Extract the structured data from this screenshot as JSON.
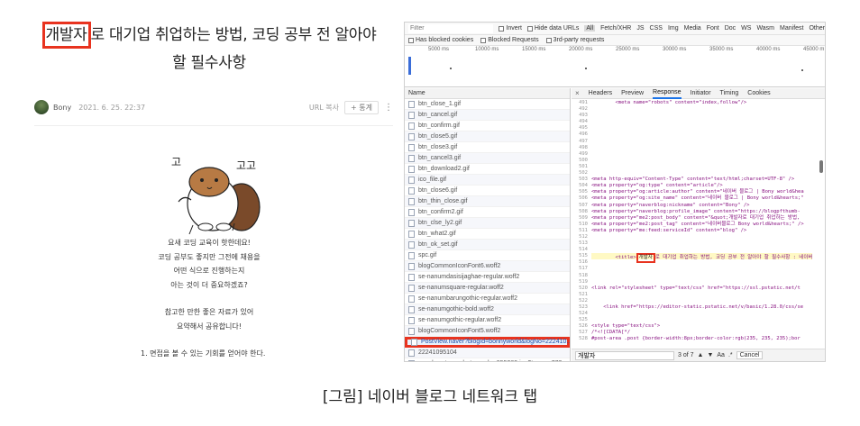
{
  "blog": {
    "title_highlight": "개발자",
    "title_rest": "로 대기업 취업하는 방법, 코딩 공부 전 알아야",
    "title_line2": "할 필수사항",
    "author": "Bony",
    "date": "2021. 6. 25. 22:37",
    "url_copy": "URL 복사",
    "share_label": "+ 통계",
    "more_icon": "more-vertical-icon",
    "mascot_text_left": "고",
    "mascot_text_right": "고고",
    "para1": [
      "요새 코딩 교육이 핫한데요!",
      "코딩 공부도 좋지만 그전에 채용을",
      "어떤 식으로 진행하는지",
      "아는 것이 더 중요하겠죠?"
    ],
    "para2": [
      "참고한 만한 좋은 자료가 있어",
      "요약해서 공유합니다!"
    ],
    "heading1": "1. 면접을 볼 수 있는 기회를 얻어야 한다."
  },
  "devtools": {
    "filter_placeholder": "Filter",
    "invert": "Invert",
    "hide_data_urls": "Hide data URLs",
    "type_tabs": [
      "All",
      "Fetch/XHR",
      "JS",
      "CSS",
      "Img",
      "Media",
      "Font",
      "Doc",
      "WS",
      "Wasm",
      "Manifest",
      "Other"
    ],
    "has_blocked_cookies": "Has blocked cookies",
    "blocked_requests": "Blocked Requests",
    "third_party": "3rd-party requests",
    "timeline_ticks": [
      "5000 ms",
      "10000 ms",
      "15000 ms",
      "20000 ms",
      "25000 ms",
      "30000 ms",
      "35000 ms",
      "40000 ms",
      "45000 m"
    ],
    "name_header": "Name",
    "rows": [
      "btn_close_1.gif",
      "btn_cancel.gif",
      "btn_confirm.gif",
      "btn_close5.gif",
      "btn_close3.gif",
      "btn_cancel3.gif",
      "btn_download2.gif",
      "ico_file.gif",
      "btn_close6.gif",
      "btn_thin_close.gif",
      "btn_confirm2.gif",
      "btn_clse_ly2.gif",
      "btn_what2.gif",
      "btn_ok_set.gif",
      "spc.gif",
      "blogCommonIconFont6.woff2",
      "se-nanumdasisijaghae-regular.woff2",
      "se-nanumsquare-regular.woff2",
      "se-nanumbarungothic-regular.woff2",
      "se-nanumgothic-bold.woff2",
      "se-nanumgothic-regular.woff2",
      "blogCommonIconFont5.woff2"
    ],
    "highlight_row": "PostView.naver?blogId=bonnyworld&logNo=222410...",
    "rows_after": [
      "22241095104",
      "pexels-cytonn-photography-955389.jpg?type=w773"
    ],
    "detail_tabs": [
      "Headers",
      "Preview",
      "Response",
      "Initiator",
      "Timing",
      "Cookies"
    ],
    "active_tab": "Response",
    "close_glyph": "×",
    "code_lines": [
      {
        "n": "491",
        "t": "        <meta name=\"robots\" content=\"index,follow\"/>"
      },
      {
        "n": "492",
        "t": ""
      },
      {
        "n": "493",
        "t": ""
      },
      {
        "n": "494",
        "t": ""
      },
      {
        "n": "495",
        "t": ""
      },
      {
        "n": "496",
        "t": ""
      },
      {
        "n": "497",
        "t": ""
      },
      {
        "n": "498",
        "t": ""
      },
      {
        "n": "499",
        "t": ""
      },
      {
        "n": "500",
        "t": ""
      },
      {
        "n": "501",
        "t": ""
      },
      {
        "n": "502",
        "t": ""
      },
      {
        "n": "503",
        "t": "<meta http-equiv=\"Content-Type\" content=\"text/html;charset=UTF-8\" />"
      },
      {
        "n": "504",
        "t": "<meta property=\"og:type\" content=\"article\"/>"
      },
      {
        "n": "505",
        "t": "<meta property=\"og:article:author\" content=\"네이버 블로그 | Bony world&hea"
      },
      {
        "n": "506",
        "t": "<meta property=\"og:site_name\" content=\"네이버 블로그 | Bony world&hearts;\""
      },
      {
        "n": "507",
        "t": "<meta property=\"naverblog:nickname\" content=\"Bony\" />"
      },
      {
        "n": "508",
        "t": "<meta property=\"naverblog:profile_image\" content=\"https://blogpfthumb-"
      },
      {
        "n": "509",
        "t": "<meta property=\"me2:post_body\" content=\"&quot;개발자로 대기업 취업하는 방법,"
      },
      {
        "n": "510",
        "t": "<meta property=\"me2:post_tag\" content=\"네이버블로그 Bony world&hearts;\" />"
      },
      {
        "n": "511",
        "t": "<meta property=\"me:feed:serviceId\" content=\"blog\" />"
      },
      {
        "n": "512",
        "t": ""
      },
      {
        "n": "513",
        "t": ""
      },
      {
        "n": "514",
        "t": ""
      }
    ],
    "title_line_no": "515",
    "title_line_pre": "        <title>",
    "title_line_mark": "개발자",
    "title_line_post": "로 대기업 취업하는 방법, 코딩 공부 전 알아야 할 필수사항 : 네이버",
    "code_lines2": [
      {
        "n": "516",
        "t": ""
      },
      {
        "n": "517",
        "t": ""
      },
      {
        "n": "518",
        "t": ""
      },
      {
        "n": "519",
        "t": ""
      },
      {
        "n": "520",
        "t": "<link rel=\"stylesheet\" type=\"text/css\" href=\"https://ssl.pstatic.net/t"
      },
      {
        "n": "521",
        "t": ""
      },
      {
        "n": "522",
        "t": ""
      },
      {
        "n": "523",
        "t": "    <link href=\"https://editor-static.pstatic.net/v/basic/1.28.0/css/se"
      },
      {
        "n": "524",
        "t": ""
      },
      {
        "n": "525",
        "t": ""
      },
      {
        "n": "526",
        "t": "<style type=\"text/css\">"
      },
      {
        "n": "527",
        "t": "/*<![CDATA[*/"
      },
      {
        "n": "528",
        "t": "#post-area .post {border-width:8px;border-color:rgb(235, 235, 235);bor"
      }
    ],
    "search_value": "개발자",
    "search_count": "3 of 7",
    "search_case": "Aa",
    "search_regex": ".*",
    "search_cancel": "Cancel"
  },
  "caption": "[그림] 네이버 블로그 네트워크 탭"
}
